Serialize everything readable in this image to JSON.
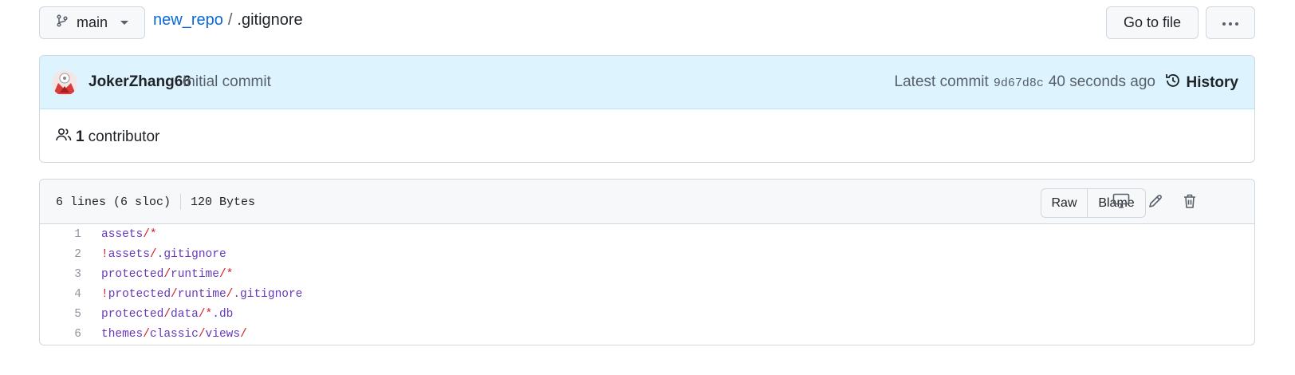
{
  "header": {
    "branch": "main",
    "repo": "new_repo",
    "separator": "/",
    "filename": ".gitignore",
    "goto_label": "Go to file",
    "more_label": "···"
  },
  "commit": {
    "author": "JokerZhang66",
    "message": "Initial commit",
    "latest_label": "Latest commit",
    "sha": "9d67d8c",
    "time": "40 seconds ago",
    "history_label": "History"
  },
  "contributors": {
    "count": "1",
    "label": "contributor"
  },
  "file": {
    "lines_info": "6 lines (6 sloc)",
    "size": "120 Bytes",
    "raw_label": "Raw",
    "blame_label": "Blame"
  },
  "code_lines": [
    {
      "num": "1",
      "parts": [
        [
          "p",
          "assets"
        ],
        [
          "r",
          "/"
        ],
        [
          "r",
          "*"
        ]
      ]
    },
    {
      "num": "2",
      "parts": [
        [
          "r",
          "!"
        ],
        [
          "p",
          "assets"
        ],
        [
          "r",
          "/"
        ],
        [
          "p",
          ".gitignore"
        ]
      ]
    },
    {
      "num": "3",
      "parts": [
        [
          "p",
          "protected"
        ],
        [
          "r",
          "/"
        ],
        [
          "p",
          "runtime"
        ],
        [
          "r",
          "/"
        ],
        [
          "r",
          "*"
        ]
      ]
    },
    {
      "num": "4",
      "parts": [
        [
          "r",
          "!"
        ],
        [
          "p",
          "protected"
        ],
        [
          "r",
          "/"
        ],
        [
          "p",
          "runtime"
        ],
        [
          "r",
          "/"
        ],
        [
          "p",
          ".gitignore"
        ]
      ]
    },
    {
      "num": "5",
      "parts": [
        [
          "p",
          "protected"
        ],
        [
          "r",
          "/"
        ],
        [
          "p",
          "data"
        ],
        [
          "r",
          "/"
        ],
        [
          "r",
          "*"
        ],
        [
          "p",
          ".db"
        ]
      ]
    },
    {
      "num": "6",
      "parts": [
        [
          "p",
          "themes"
        ],
        [
          "r",
          "/"
        ],
        [
          "p",
          "classic"
        ],
        [
          "r",
          "/"
        ],
        [
          "p",
          "views"
        ],
        [
          "r",
          "/"
        ]
      ]
    }
  ],
  "colors": {
    "link": "#0969da",
    "commit_bg": "#ddf4ff",
    "code_purple": "#6639ba",
    "code_red": "#cf222e"
  }
}
